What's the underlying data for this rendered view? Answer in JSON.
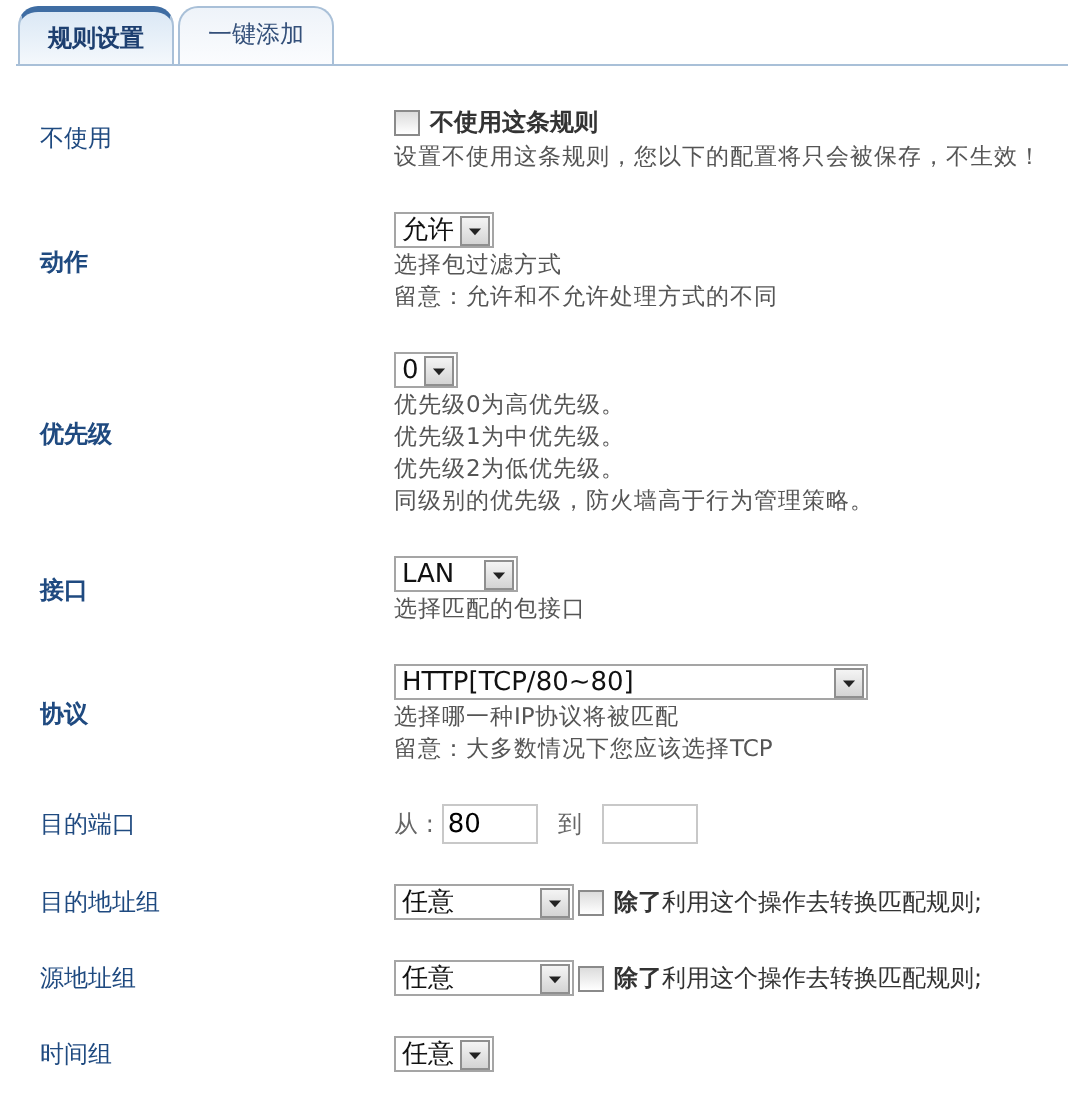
{
  "tabs": [
    {
      "label": "规则设置",
      "selected": true
    },
    {
      "label": "一键添加",
      "selected": false
    }
  ],
  "rows": [
    {
      "label": "不使用",
      "bold": false,
      "kind": "checkbox",
      "checkbox": {
        "label": "不使用这条规则",
        "checked": false
      },
      "notes": [
        "设置不使用这条规则，您以下的配置将只会被保存，不生效！"
      ]
    },
    {
      "label": "动作",
      "bold": true,
      "kind": "select",
      "select": "允许",
      "notes": [
        "选择包过滤方式",
        "留意：允许和不允许处理方式的不同"
      ]
    },
    {
      "label": "优先级",
      "bold": true,
      "kind": "select",
      "select": "0",
      "notes": [
        "优先级0为高优先级。",
        "优先级1为中优先级。",
        "优先级2为低优先级。",
        "同级别的优先级，防火墙高于行为管理策略。"
      ]
    },
    {
      "label": "接口",
      "bold": true,
      "kind": "select",
      "select": "LAN",
      "notes": [
        "选择匹配的包接口"
      ]
    },
    {
      "label": "协议",
      "bold": true,
      "kind": "select",
      "select": "HTTP[TCP/80~80]",
      "notes": [
        "选择哪一种IP协议将被匹配",
        "留意：大多数情况下您应该选择TCP"
      ]
    },
    {
      "label": "目的端口",
      "bold": false,
      "kind": "ports",
      "from_label": "从 :",
      "from_value": "80",
      "to_label": "到"
    },
    {
      "label": "目的地址组",
      "bold": false,
      "kind": "select_except",
      "select": "任意",
      "checkbox": {
        "label": "**除了**利用这个操作去转换匹配规则;",
        "checked": false
      }
    },
    {
      "label": "源地址组",
      "bold": false,
      "kind": "select_except",
      "select": "任意",
      "checkbox": {
        "label": "**除了**利用这个操作去转换匹配规则;",
        "checked": false
      }
    },
    {
      "label": "时间组",
      "bold": false,
      "kind": "select",
      "select": "任意"
    }
  ]
}
